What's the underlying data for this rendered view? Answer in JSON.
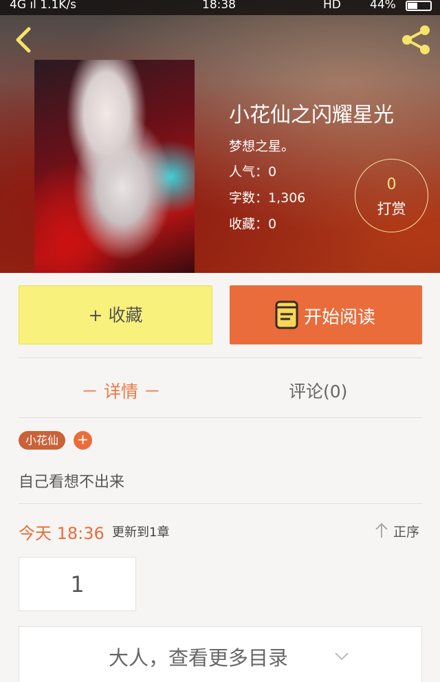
{
  "status_bar": {
    "network": "4G ıl  1.1K/s",
    "time": "18:38",
    "hd": "HD",
    "battery": "44%",
    "battery_level_percent": 44
  },
  "header": {
    "back_icon": "chevron-left-icon",
    "share_icon": "share-icon",
    "icon_color": "#f5e36a"
  },
  "book": {
    "title": "小花仙之闪耀星光",
    "author": "梦想之星。",
    "popularity": "人气：0",
    "word_count": "字数：1,306",
    "favorites": "收藏：0"
  },
  "reward": {
    "count": "0",
    "label": "打赏"
  },
  "actions": {
    "favorite_label": "+ 收藏",
    "read_label": "开始阅读",
    "favorite_color": "#f8f17b",
    "read_color": "#ea6c3b"
  },
  "tabs": {
    "detail": "－ 详情 －",
    "comments": "评论(0)"
  },
  "tags": {
    "items": [
      "小花仙"
    ],
    "add": "+"
  },
  "description": "自己看想不出来",
  "update": {
    "time": "今天 18:36",
    "text": "更新到1章",
    "sort_label": "正序"
  },
  "chapters": {
    "page": "1",
    "more_label": "大人，查看更多目录"
  }
}
